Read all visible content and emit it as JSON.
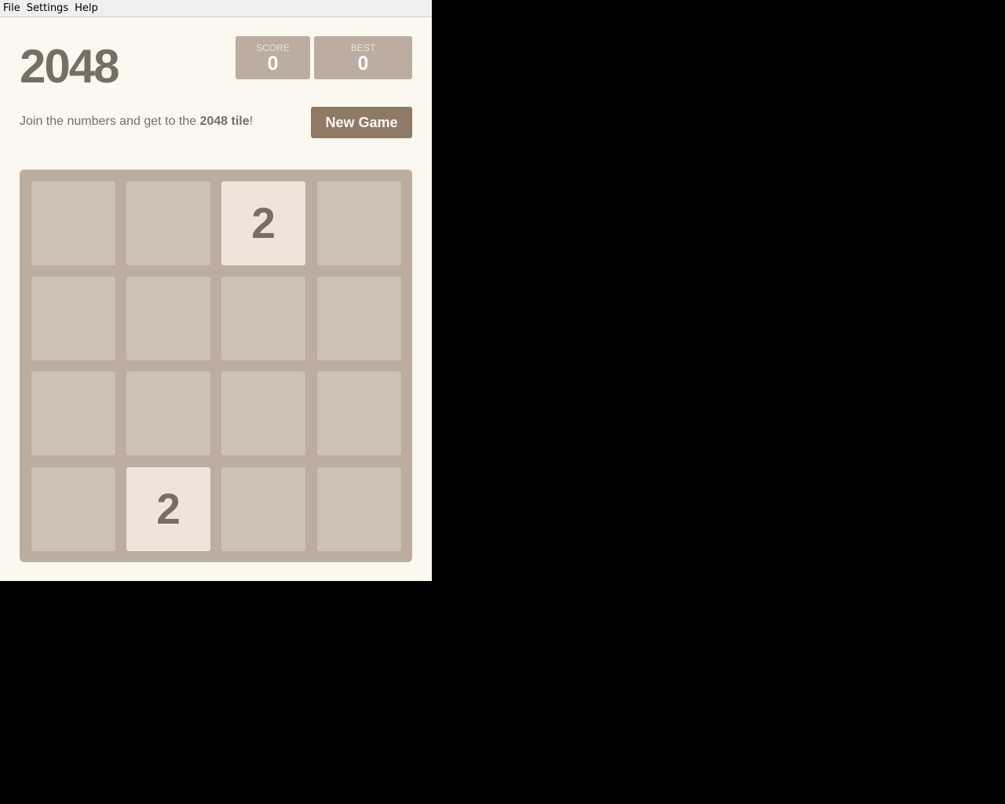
{
  "menu": [
    "File",
    "Settings",
    "Help"
  ],
  "title": "2048",
  "score": {
    "label": "SCORE",
    "value": "0"
  },
  "best": {
    "label": "BEST",
    "value": "0"
  },
  "intro": {
    "prefix": "Join the numbers and get to the ",
    "bold": "2048 tile",
    "suffix": "!"
  },
  "new_game_label": "New Game",
  "board": [
    [
      "",
      "",
      "2",
      ""
    ],
    [
      "",
      "",
      "",
      ""
    ],
    [
      "",
      "",
      "",
      ""
    ],
    [
      "",
      "2",
      "",
      ""
    ]
  ],
  "colors": {
    "background": "#faf8ef",
    "board": "#bbada0",
    "empty_cell": "#cdc1b4",
    "tile_2": "#eee4da",
    "text": "#776e65",
    "button": "#8f7a66"
  }
}
